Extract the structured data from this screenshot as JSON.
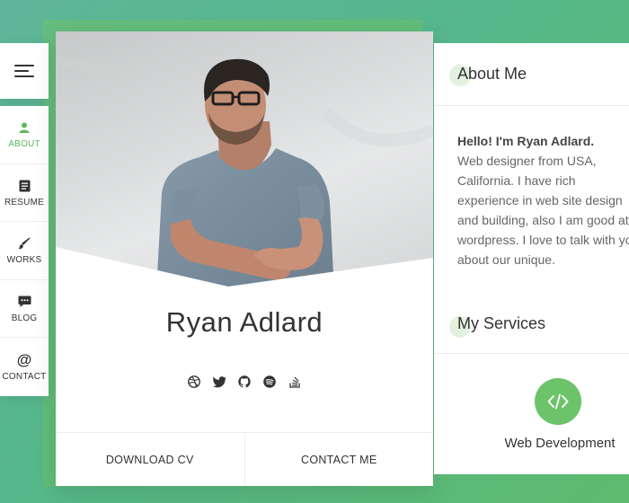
{
  "colors": {
    "accent": "#6cc36a",
    "active_nav": "#5fb85e"
  },
  "menu": {
    "icon": "hamburger-icon"
  },
  "nav": {
    "items": [
      {
        "label": "ABOUT",
        "icon": "user-icon",
        "active": true
      },
      {
        "label": "RESUME",
        "icon": "document-icon",
        "active": false
      },
      {
        "label": "WORKS",
        "icon": "brush-icon",
        "active": false
      },
      {
        "label": "BLOG",
        "icon": "chat-icon",
        "active": false
      },
      {
        "label": "CONTACT",
        "icon": "at-icon",
        "active": false
      }
    ]
  },
  "profile": {
    "name": "Ryan Adlard",
    "social_icons": [
      "dribbble-icon",
      "twitter-icon",
      "github-icon",
      "spotify-icon",
      "stackoverflow-icon"
    ],
    "download_label": "DOWNLOAD CV",
    "contact_label": "CONTACT ME"
  },
  "about": {
    "title": "About Me",
    "greeting": "Hello! I'm Ryan Adlard.",
    "lines": [
      "Web designer from USA,",
      "California. I have rich",
      "experience in web site design",
      "and building, also I am good at",
      "wordpress. I love to talk with you",
      "about our unique."
    ]
  },
  "services": {
    "title": "My Services",
    "items": [
      {
        "label": "Web Development",
        "icon": "code-icon"
      }
    ]
  }
}
